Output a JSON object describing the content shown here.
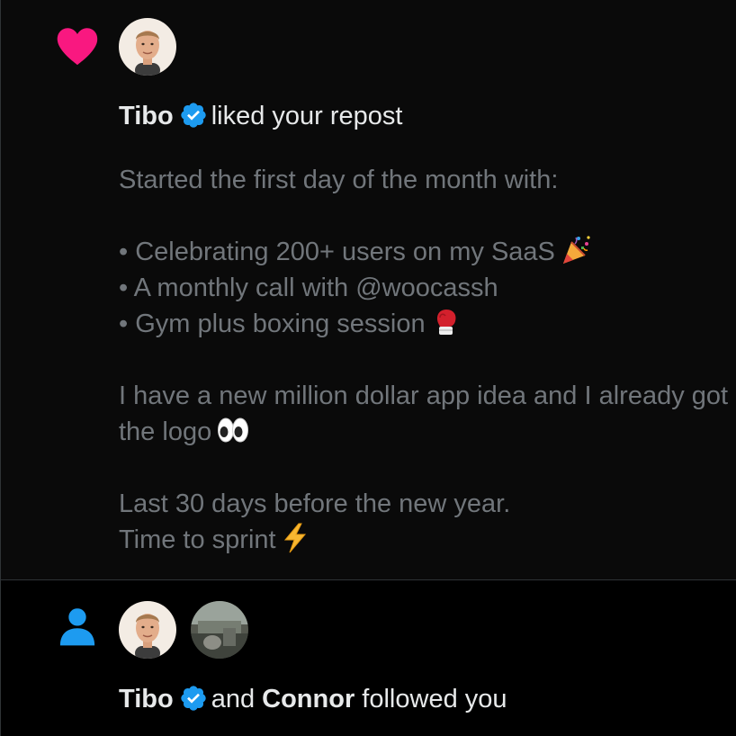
{
  "notifications": [
    {
      "type": "like",
      "icon": "heart-icon",
      "icon_color": "#f91880",
      "actor": "Tibo",
      "actor_verified": true,
      "action": "liked your repost",
      "post": {
        "line1": "Started the first day of the month with:",
        "bullet1": "• Celebrating 200+ users on my SaaS",
        "bullet1_emoji": "party-popper-emoji",
        "bullet2": "• A monthly call with @woocassh",
        "bullet3": "• Gym plus boxing session",
        "bullet3_emoji": "boxing-glove-emoji",
        "line2": "I have a new million dollar app idea and I already got",
        "line3": "the logo",
        "line3_emoji": "eyes-emoji",
        "line4": "Last 30 days before the new year.",
        "line5": "Time to sprint",
        "line5_emoji": "high-voltage-emoji"
      }
    },
    {
      "type": "follow",
      "icon": "person-icon",
      "icon_color": "#1d9bf0",
      "actor1": "Tibo",
      "actor1_verified": true,
      "conjunction": "and",
      "actor2": "Connor",
      "action": "followed you"
    }
  ],
  "colors": {
    "verified_badge": "#1d9bf0",
    "secondary_text": "#71767b",
    "primary_text": "#e7e9ea",
    "divider": "#2f3336"
  }
}
